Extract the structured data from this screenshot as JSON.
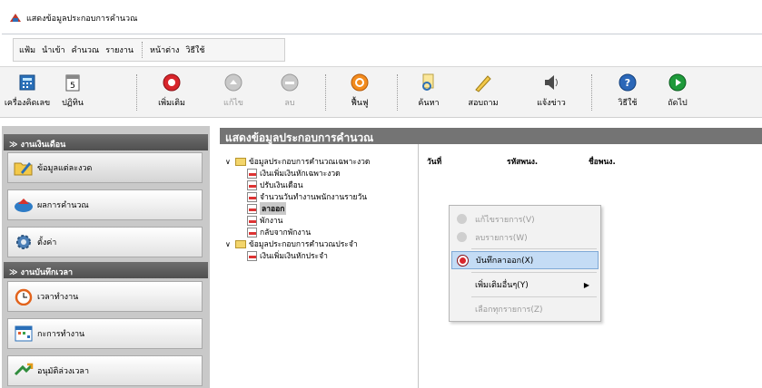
{
  "window": {
    "title": "แสดงข้อมูลประกอบการคำนวณ"
  },
  "menubar": {
    "items": [
      "แฟ้ม",
      "นำเข้า",
      "คำนวณ",
      "รายงาน"
    ],
    "items2": [
      "หน้าต่าง",
      "วิธีใช้"
    ]
  },
  "toolbar": {
    "calc": "เครื่องคิดเลข",
    "calendar": "ปฏิทิน",
    "calendar_day": "5",
    "add": "เพิ่มเติม",
    "edit": "แก้ไข",
    "delete": "ลบ",
    "restore": "ฟื้นฟู",
    "search": "ค้นหา",
    "ask": "สอบถาม",
    "notify": "แจ้งข่าว",
    "help": "วิธีใช้",
    "next": "ถัดไป"
  },
  "sidebar": {
    "section1": "งานเงินเดือน",
    "items1": [
      "ข้อมูลแต่ละงวด",
      "ผลการคำนวณ",
      "ตั้งค่า"
    ],
    "section2": "งานบันทึกเวลา",
    "items2": [
      "เวลาทำงาน",
      "กะการทำงาน",
      "อนุมัติล่วงเวลา"
    ]
  },
  "main": {
    "title": "แสดงข้อมูลประกอบการคำนวณ"
  },
  "tree": {
    "group1": "ข้อมูลประกอบการคำนวณเฉพาะงวด",
    "g1_items": [
      "เงินเพิ่มเงินหักเฉพาะงวด",
      "ปรับเงินเดือน",
      "จำนวนวันทำงานพนักงานรายวัน",
      "ลาออก",
      "พักงาน",
      "กลับจากพักงาน"
    ],
    "group2": "ข้อมูลประกอบการคำนวณประจำ",
    "g2_items": [
      "เงินเพิ่มเงินหักประจำ"
    ]
  },
  "grid": {
    "columns": [
      "วันที่",
      "รหัสพนง.",
      "ชื่อพนง."
    ]
  },
  "context_menu": {
    "edit": "แก้ไขรายการ(V)",
    "delete": "ลบรายการ(W)",
    "add_resign": "บันทึกลาออก(X)",
    "add_other": "เพิ่มเติมอื่นๆ(Y)",
    "select_all": "เลือกทุกรายการ(Z)"
  },
  "colors": {
    "accent": "#c4dcf5",
    "header": "#747474",
    "sidebar": "#c9c9c9"
  }
}
